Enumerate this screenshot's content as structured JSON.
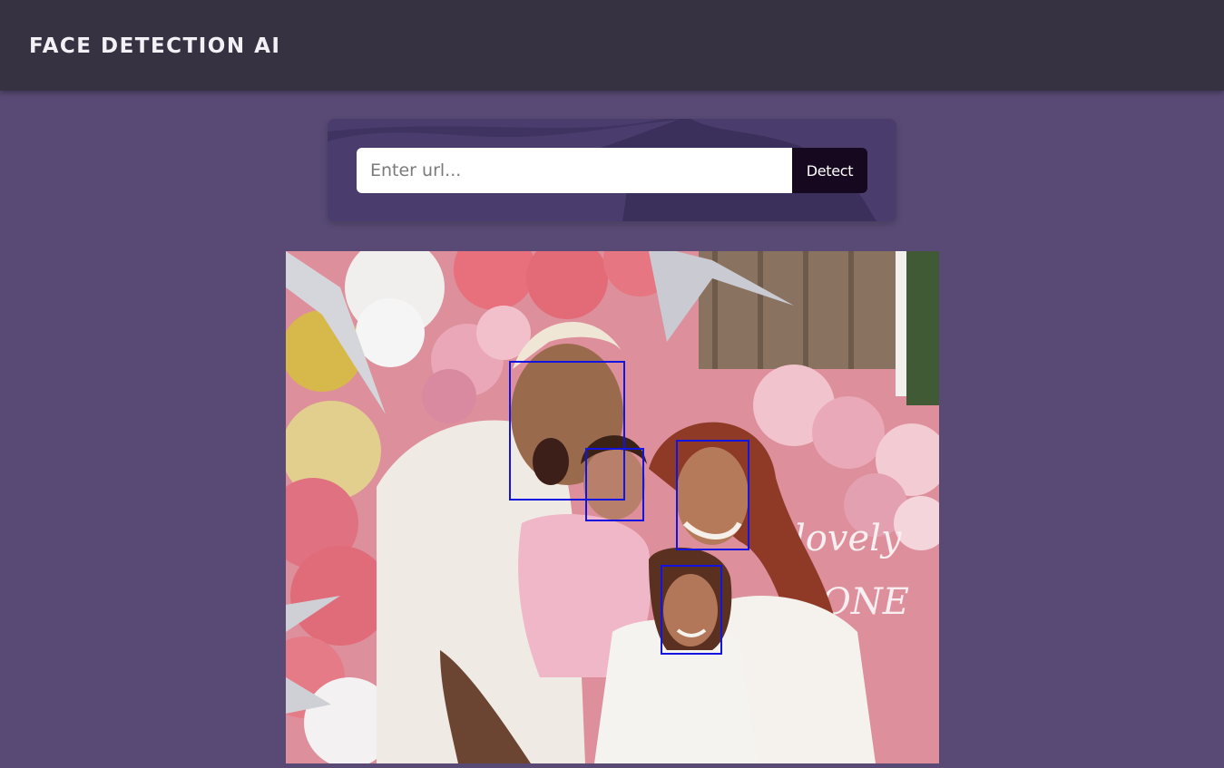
{
  "header": {
    "title": "FACE DETECTION AI"
  },
  "search": {
    "placeholder": "Enter url...",
    "value": "",
    "button_label": "Detect"
  },
  "result": {
    "face_count": 4
  },
  "colors": {
    "page_background": "#584a74",
    "navbar": "#363241",
    "card": "#4a3d6d",
    "button": "#16091f",
    "face_box": "#1414e0"
  }
}
